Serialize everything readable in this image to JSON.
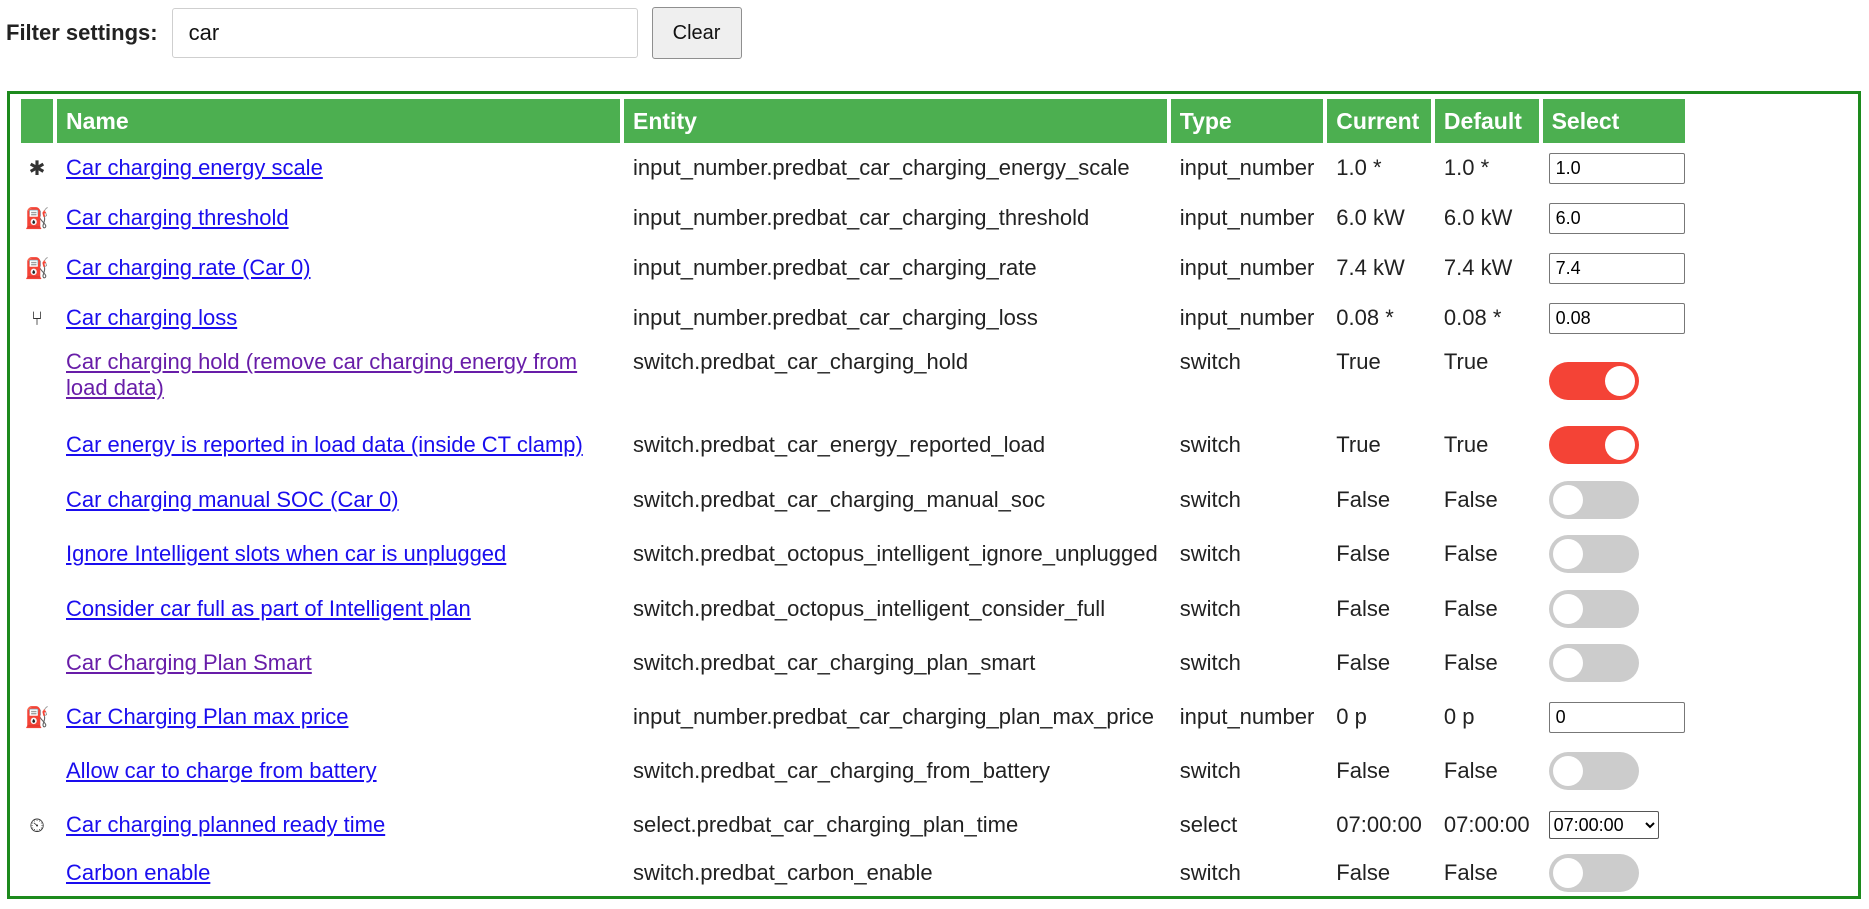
{
  "filter": {
    "label": "Filter settings:",
    "value": "car",
    "clear_label": "Clear"
  },
  "table": {
    "headers": [
      "Name",
      "Entity",
      "Type",
      "Current",
      "Default",
      "Select"
    ],
    "rows": [
      {
        "icon": "asterisk-icon",
        "glyph": "✱",
        "name": "Car charging energy scale",
        "entity": "input_number.predbat_car_charging_energy_scale",
        "type": "input_number",
        "current": "1.0 *",
        "default": "1.0 *",
        "control": "number",
        "value": "1.0",
        "visited": false
      },
      {
        "icon": "ev-station-icon",
        "glyph": "⛽",
        "name": "Car charging threshold",
        "entity": "input_number.predbat_car_charging_threshold",
        "type": "input_number",
        "current": "6.0 kW",
        "default": "6.0 kW",
        "control": "number",
        "value": "6.0",
        "visited": false
      },
      {
        "icon": "ev-station-icon",
        "glyph": "⛽",
        "name": "Car charging rate (Car 0)",
        "entity": "input_number.predbat_car_charging_rate",
        "type": "input_number",
        "current": "7.4 kW",
        "default": "7.4 kW",
        "control": "number",
        "value": "7.4",
        "visited": false
      },
      {
        "icon": "call-split-icon",
        "glyph": "⑂",
        "name": "Car charging loss",
        "entity": "input_number.predbat_car_charging_loss",
        "type": "input_number",
        "current": "0.08 *",
        "default": "0.08 *",
        "control": "number",
        "value": "0.08",
        "visited": false
      },
      {
        "icon": "",
        "glyph": "",
        "name": "Car charging hold (remove car charging energy from load data)",
        "entity": "switch.predbat_car_charging_hold",
        "type": "switch",
        "current": "True",
        "default": "True",
        "control": "switch",
        "on": true,
        "visited": true
      },
      {
        "icon": "",
        "glyph": "",
        "name": "Car energy is reported in load data (inside CT clamp)",
        "entity": "switch.predbat_car_energy_reported_load",
        "type": "switch",
        "current": "True",
        "default": "True",
        "control": "switch",
        "on": true,
        "visited": false
      },
      {
        "icon": "",
        "glyph": "",
        "name": "Car charging manual SOC (Car 0)",
        "entity": "switch.predbat_car_charging_manual_soc",
        "type": "switch",
        "current": "False",
        "default": "False",
        "control": "switch",
        "on": false,
        "visited": false
      },
      {
        "icon": "",
        "glyph": "",
        "name": "Ignore Intelligent slots when car is unplugged",
        "entity": "switch.predbat_octopus_intelligent_ignore_unplugged",
        "type": "switch",
        "current": "False",
        "default": "False",
        "control": "switch",
        "on": false,
        "visited": false
      },
      {
        "icon": "",
        "glyph": "",
        "name": "Consider car full as part of Intelligent plan",
        "entity": "switch.predbat_octopus_intelligent_consider_full",
        "type": "switch",
        "current": "False",
        "default": "False",
        "control": "switch",
        "on": false,
        "visited": false
      },
      {
        "icon": "",
        "glyph": "",
        "name": "Car Charging Plan Smart",
        "entity": "switch.predbat_car_charging_plan_smart",
        "type": "switch",
        "current": "False",
        "default": "False",
        "control": "switch",
        "on": false,
        "visited": true
      },
      {
        "icon": "ev-station-icon",
        "glyph": "⛽",
        "name": "Car Charging Plan max price",
        "entity": "input_number.predbat_car_charging_plan_max_price",
        "type": "input_number",
        "current": "0 p",
        "default": "0 p",
        "control": "number",
        "value": "0",
        "visited": false
      },
      {
        "icon": "",
        "glyph": "",
        "name": "Allow car to charge from battery",
        "entity": "switch.predbat_car_charging_from_battery",
        "type": "switch",
        "current": "False",
        "default": "False",
        "control": "switch",
        "on": false,
        "visited": false
      },
      {
        "icon": "clock-play-icon",
        "glyph": "⏲",
        "name": "Car charging planned ready time",
        "entity": "select.predbat_car_charging_plan_time",
        "type": "select",
        "current": "07:00:00",
        "default": "07:00:00",
        "control": "select",
        "value": "07:00:00",
        "visited": false
      },
      {
        "icon": "",
        "glyph": "",
        "name": "Carbon enable",
        "entity": "switch.predbat_carbon_enable",
        "type": "switch",
        "current": "False",
        "default": "False",
        "control": "switch",
        "on": false,
        "visited": false
      }
    ]
  },
  "colors": {
    "header_green": "#4caf50",
    "frame_green": "#1d8a1d",
    "switch_on": "#f44336",
    "switch_off": "#cccccc",
    "link": "#1a0dee",
    "link_visited": "#681da8"
  }
}
